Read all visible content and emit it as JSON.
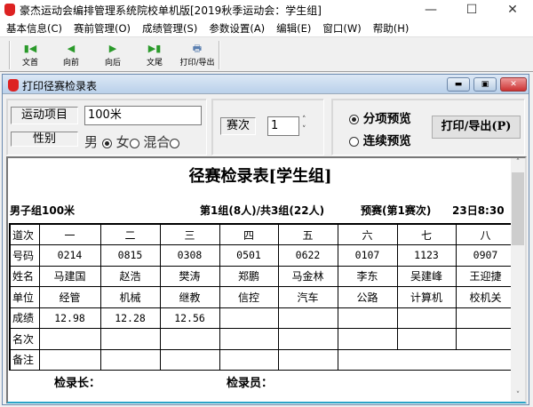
{
  "app": {
    "title": "豪杰运动会编排管理系统院校单机版[2019秋季运动会：学生组]"
  },
  "menu": [
    "基本信息(C)",
    "赛前管理(O)",
    "成绩管理(S)",
    "参数设置(A)",
    "编辑(E)",
    "窗口(W)",
    "帮助(H)"
  ],
  "toolbar": [
    {
      "label": "文首",
      "icon": "first-icon"
    },
    {
      "label": "向前",
      "icon": "prev-icon"
    },
    {
      "label": "向后",
      "icon": "next-icon"
    },
    {
      "label": "文尾",
      "icon": "last-icon"
    },
    {
      "label": "打印/导出",
      "icon": "printer-icon"
    }
  ],
  "child": {
    "title": "打印径赛检录表"
  },
  "form": {
    "event_label": "运动项目",
    "event_value": "100米",
    "gender_label": "性别",
    "gender_options": [
      "男",
      "女",
      "混合"
    ],
    "gender_selected": "男",
    "round_label": "赛次",
    "round_value": "1",
    "preview_options": [
      "分项预览",
      "连续预览"
    ],
    "preview_selected": "分项预览",
    "print_button": "打印/导出(P)"
  },
  "report": {
    "title": "径赛检录表[学生组]",
    "event": "男子组100米",
    "group": "第1组(8人)/共3组(22人)",
    "stage": "预赛(第1赛次)",
    "time": "23日8:30",
    "row_labels": [
      "道次",
      "号码",
      "姓名",
      "单位",
      "成绩",
      "名次",
      "备注"
    ],
    "lanes": [
      "一",
      "二",
      "三",
      "四",
      "五",
      "六",
      "七",
      "八"
    ],
    "numbers": [
      "0214",
      "0815",
      "0308",
      "0501",
      "0622",
      "0107",
      "1123",
      "0907"
    ],
    "names": [
      "马建国",
      "赵浩",
      "樊涛",
      "郑鹏",
      "马金林",
      "李东",
      "吴建峰",
      "王迎捷"
    ],
    "units": [
      "经管",
      "机械",
      "继教",
      "信控",
      "汽车",
      "公路",
      "计算机",
      "校机关"
    ],
    "results": [
      "12.98",
      "12.28",
      "12.56",
      "",
      "",
      "",
      "",
      ""
    ],
    "chief_label": "检录长：",
    "clerk_label": "检录员："
  }
}
